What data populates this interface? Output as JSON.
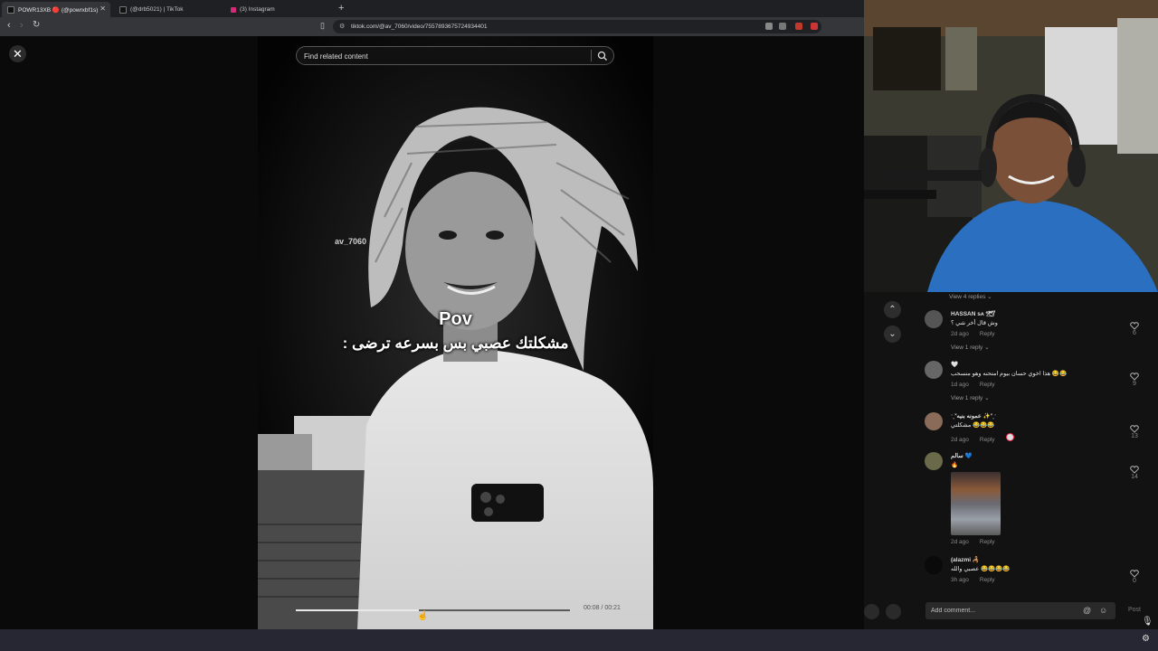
{
  "browser": {
    "tabs": [
      {
        "label": "POWR13XB 🔴 (@powrxbf1s)",
        "active": true
      },
      {
        "label": "(@drb5021) | TikTok",
        "active": false
      },
      {
        "label": "(3) Instagram",
        "active": false
      }
    ],
    "url": "tiktok.com/@av_7060/video/7557893675724934401"
  },
  "video": {
    "search_placeholder": "Find related content",
    "watermark": "av_7060",
    "caption_line1": "Pov",
    "caption_line2": "مشكلتك عصبي بس بسرعه ترضى :",
    "progress": 0.45,
    "time_display": "00:08 / 00:21"
  },
  "comments": {
    "top_view_replies": "View 4 replies",
    "items": [
      {
        "name": "HASSAN ѕᴀ *̷͟͞🕊",
        "text": "وش قال أخر شي ؟",
        "age": "2d ago",
        "reply": "Reply",
        "likes": "6",
        "view_replies": "View 1 reply"
      },
      {
        "name": "🤍",
        "text": "هذا اخوي حسان بيوم امتحنه وهو منسحب 😂😂",
        "age": "1d ago",
        "reply": "Reply",
        "likes": "9",
        "view_replies": "View 1 reply"
      },
      {
        "name": "ˑ˳˟عمونه بنيه ✨˟˳ˑ",
        "text": "مشكلتي 😂😂😂",
        "age": "2d ago",
        "reply": "Reply",
        "likes": "13"
      },
      {
        "name": "سالم 💙",
        "text": "🔥",
        "age": "2d ago",
        "reply": "Reply",
        "likes": "14"
      },
      {
        "name": "(alazmi 🦂",
        "text": "عصبي والله 😂😂😂😂",
        "age": "3h ago",
        "reply": "Reply",
        "likes": "0"
      }
    ],
    "add_comment_placeholder": "Add comment...",
    "post_label": "Post"
  },
  "colors": {
    "accent": "#fe2c55",
    "panel": "#121212",
    "chrome": "#35363a"
  }
}
